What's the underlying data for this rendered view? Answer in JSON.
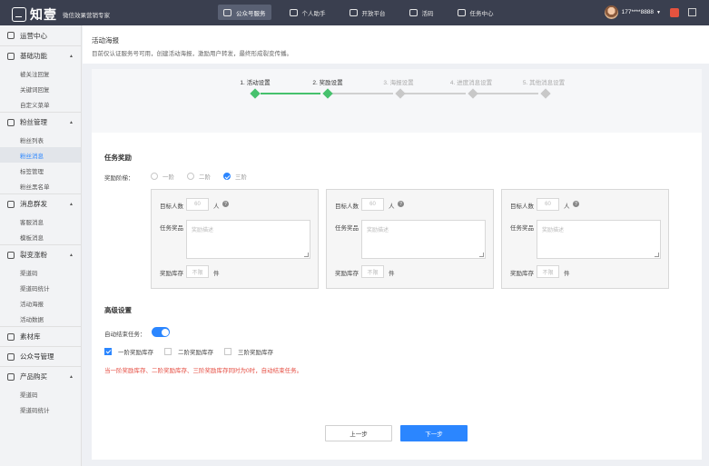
{
  "app": {
    "logo_text": "知壹",
    "tagline": "微信效果营销专家"
  },
  "topnav": [
    {
      "label": "公众号服务",
      "icon": "chat-icon",
      "active": true
    },
    {
      "label": "个人助手",
      "icon": "briefcase-icon",
      "active": false
    },
    {
      "label": "开放平台",
      "icon": "monitor-icon",
      "active": false
    },
    {
      "label": "活码",
      "icon": "qrcode-icon",
      "active": false
    },
    {
      "label": "任务中心",
      "icon": "task-icon",
      "active": false
    }
  ],
  "user": {
    "phone": "177****8888",
    "caret": "▼"
  },
  "sidebar": {
    "groups": [
      {
        "title": "运营中心",
        "icon": "dashboard-icon",
        "items": []
      },
      {
        "title": "基础功能",
        "icon": "grid-icon",
        "items": [
          "被关注回复",
          "关键词回复",
          "自定义菜单"
        ]
      },
      {
        "title": "粉丝管理",
        "icon": "heart-icon",
        "items": [
          "粉丝列表",
          "粉丝消息",
          "标签管理",
          "粉丝黑名单"
        ]
      },
      {
        "title": "消息群发",
        "icon": "mail-icon",
        "items": [
          "客服消息",
          "模板消息"
        ]
      },
      {
        "title": "裂变涨粉",
        "icon": "share-icon",
        "items": [
          "渠道码",
          "渠道码统计",
          "活动海报",
          "活动数据"
        ]
      },
      {
        "title": "素材库",
        "icon": "folder-icon",
        "items": []
      },
      {
        "title": "公众号管理",
        "icon": "person-icon",
        "items": []
      },
      {
        "title": "产品购买",
        "icon": "cart-icon",
        "items": [
          "渠道码",
          "渠道码统计"
        ]
      }
    ],
    "active_item": "粉丝消息",
    "caret": "▲"
  },
  "page": {
    "title": "活动海报",
    "desc": "目前仅认证服务号可用，创建活动海报，激励用户转发，最终形成裂变传播。"
  },
  "steps": [
    {
      "label": "1. 活动设置",
      "done": true
    },
    {
      "label": "2. 奖励设置",
      "done": true
    },
    {
      "label": "3. 海报设置",
      "done": false
    },
    {
      "label": "4. 进度消息设置",
      "done": false
    },
    {
      "label": "5. 其他消息设置",
      "done": false
    }
  ],
  "reward": {
    "section_title": "任务奖励",
    "tier_label": "奖励阶梯：",
    "tier_options": [
      "一阶",
      "二阶",
      "三阶"
    ],
    "tier_selected": 2,
    "target_label": "目标人数",
    "target_unit": "人",
    "help_glyph": "?",
    "prize_label": "任务奖品",
    "stock_label": "奖励库存",
    "stock_unit": "件",
    "tiers": [
      {
        "target_placeholder": "60",
        "prize_placeholder": "奖励描述",
        "stock_placeholder": "不限"
      },
      {
        "target_placeholder": "60",
        "prize_placeholder": "奖励描述",
        "stock_placeholder": "不限"
      },
      {
        "target_placeholder": "60",
        "prize_placeholder": "奖励描述",
        "stock_placeholder": "不限"
      }
    ]
  },
  "advanced": {
    "section_title": "高级设置",
    "auto_end_label": "自动结束任务：",
    "auto_end_on": true,
    "checks": [
      {
        "label": "一阶奖励库存",
        "checked": true
      },
      {
        "label": "二阶奖励库存",
        "checked": false
      },
      {
        "label": "三阶奖励库存",
        "checked": false
      }
    ],
    "warning": "当一阶奖励库存、二阶奖励库存、三阶奖励库存同时为0时，自动结束任务。"
  },
  "buttons": {
    "prev": "上一步",
    "next": "下一步"
  },
  "colors": {
    "topbar": "#3a3f4f",
    "accent": "#2b86ff",
    "step_done": "#46c16d",
    "warning": "#e54d42"
  }
}
